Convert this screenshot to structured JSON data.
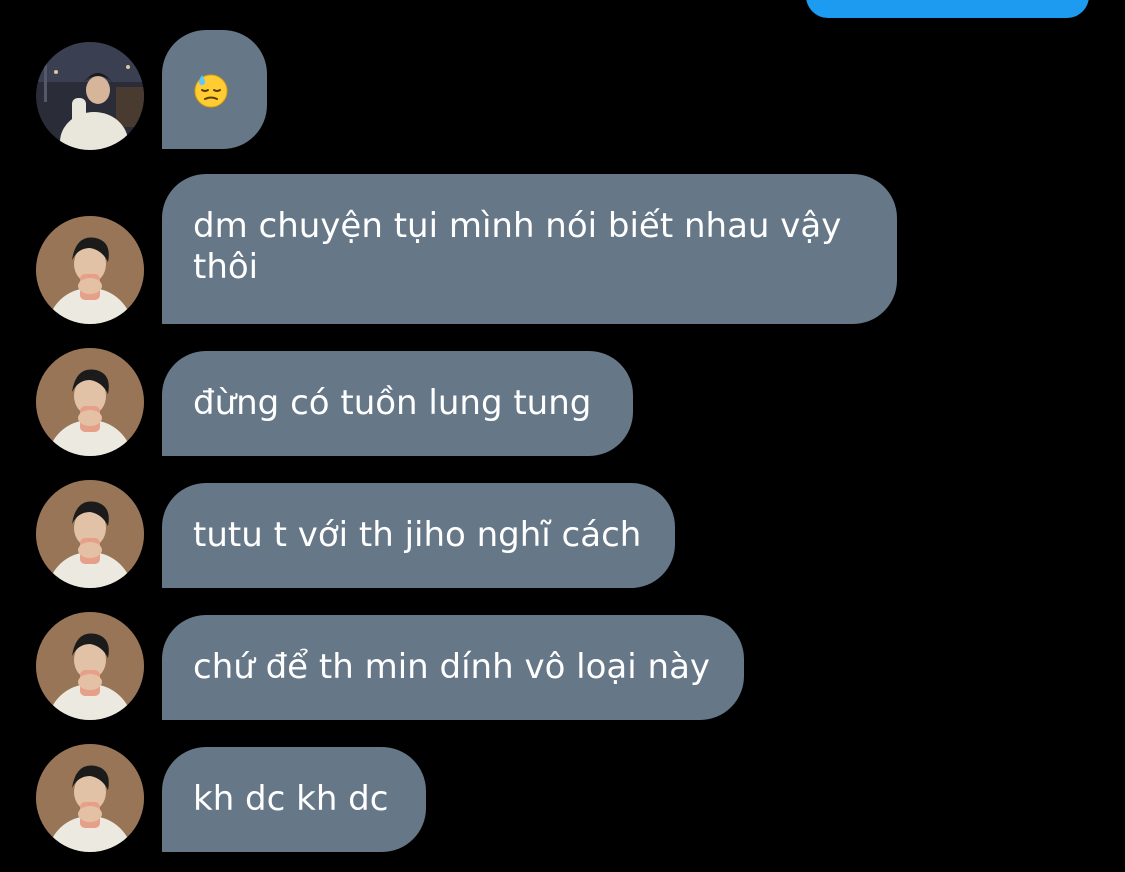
{
  "conversation": {
    "incoming_color": "#667788",
    "outgoing_color": "#1d9bf0",
    "emoji_message": {
      "icon": "downcast-face-with-sweat-emoji"
    },
    "messages": [
      {
        "text": "dm chuyện tụi mình nói biết nhau vậy thôi"
      },
      {
        "text": "đừng có tuồn lung tung"
      },
      {
        "text": "tutu t với th jiho nghĩ cách"
      },
      {
        "text": "chứ để th min dính vô loại này"
      },
      {
        "text": "kh dc kh dc"
      }
    ]
  }
}
